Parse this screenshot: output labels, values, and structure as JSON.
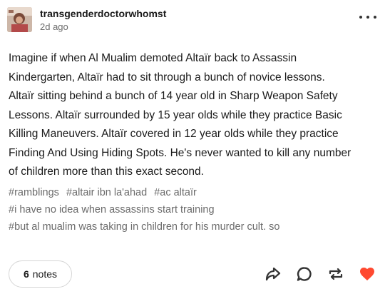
{
  "post": {
    "username": "transgenderdoctorwhomst",
    "timestamp": "2d ago",
    "body_lines": [
      "Imagine if when Al Mualim demoted Altaïr back to Assassin",
      "Kindergarten, Altaïr had to sit through a bunch of novice lessons.",
      "Altaïr sitting behind a bunch of 14 year old in Sharp Weapon Safety",
      "Lessons. Altaïr surrounded by 15 year olds while they practice Basic",
      "Killing Maneuvers.  Altaïr covered in 12 year olds while they practice",
      "Finding And Using Hiding Spots. He's never wanted to kill any number",
      "of children more than this exact second."
    ],
    "tags": {
      "row1": [
        "#ramblings",
        "#altair ibn la'ahad",
        "#ac altaïr"
      ],
      "row2": "#i have no idea when assassins start training",
      "row3": "#but al mualim was taking in children for his murder cult. so"
    }
  },
  "footer": {
    "notes_count": "6",
    "notes_label": "notes",
    "icons": [
      "share-icon",
      "reply-icon",
      "reblog-icon",
      "like-heart-icon"
    ],
    "like_color": "#ff4930"
  }
}
